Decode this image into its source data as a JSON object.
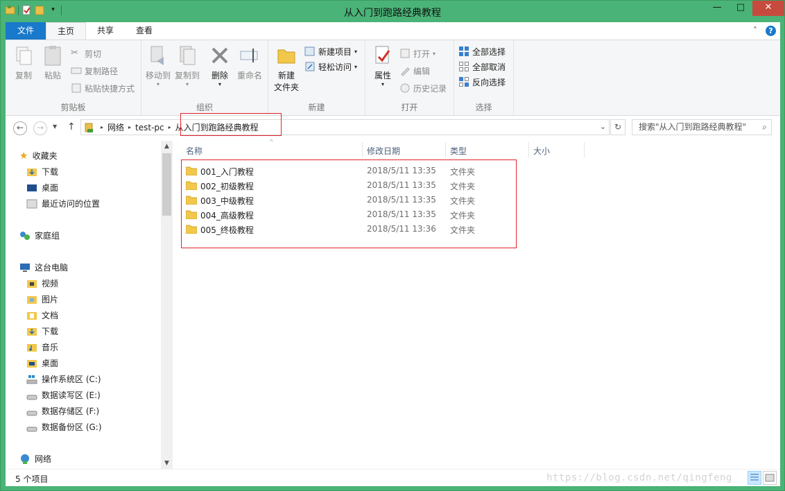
{
  "window": {
    "title": "从入门到跑路经典教程"
  },
  "tabs": [
    {
      "label": "文件"
    },
    {
      "label": "主页"
    },
    {
      "label": "共享"
    },
    {
      "label": "查看"
    }
  ],
  "ribbon": {
    "clipboard": {
      "label": "剪贴板",
      "copy": "复制",
      "paste": "粘贴",
      "cut": "剪切",
      "copy_path": "复制路径",
      "paste_shortcut": "粘贴快捷方式"
    },
    "organize": {
      "label": "组织",
      "move_to": "移动到",
      "copy_to": "复制到",
      "delete": "删除",
      "rename": "重命名"
    },
    "new": {
      "label": "新建",
      "new_folder_1": "新建",
      "new_folder_2": "文件夹",
      "new_item": "新建项目",
      "easy_access": "轻松访问"
    },
    "open": {
      "label": "打开",
      "properties": "属性",
      "open": "打开",
      "edit": "编辑",
      "history": "历史记录"
    },
    "select": {
      "label": "选择",
      "select_all": "全部选择",
      "select_none": "全部取消",
      "invert": "反向选择"
    }
  },
  "address": {
    "segments": [
      "网络",
      "test-pc",
      "从入门到跑路经典教程"
    ],
    "search_placeholder": "搜索\"从入门到跑路经典教程\""
  },
  "nav": {
    "favorites": "收藏夹",
    "fav_items": [
      "下载",
      "桌面",
      "最近访问的位置"
    ],
    "homegroup": "家庭组",
    "this_pc": "这台电脑",
    "pc_items": [
      "视频",
      "图片",
      "文档",
      "下载",
      "音乐",
      "桌面",
      "操作系统区 (C:)",
      "数据读写区 (E:)",
      "数据存储区 (F:)",
      "数据备份区 (G:)"
    ],
    "network": "网络"
  },
  "columns": {
    "name": "名称",
    "date": "修改日期",
    "type": "类型",
    "size": "大小"
  },
  "files": [
    {
      "name": "001_入门教程",
      "date": "2018/5/11 13:35",
      "type": "文件夹"
    },
    {
      "name": "002_初级教程",
      "date": "2018/5/11 13:35",
      "type": "文件夹"
    },
    {
      "name": "003_中级教程",
      "date": "2018/5/11 13:35",
      "type": "文件夹"
    },
    {
      "name": "004_高级教程",
      "date": "2018/5/11 13:35",
      "type": "文件夹"
    },
    {
      "name": "005_终极教程",
      "date": "2018/5/11 13:36",
      "type": "文件夹"
    }
  ],
  "status": {
    "count": "5 个项目"
  },
  "watermark": "https://blog.csdn.net/qingfeng",
  "colors": {
    "title_bar": "#4ab377",
    "file_tab": "#1979ca",
    "highlight_box": "#e0242c",
    "close": "#c74a3f"
  }
}
